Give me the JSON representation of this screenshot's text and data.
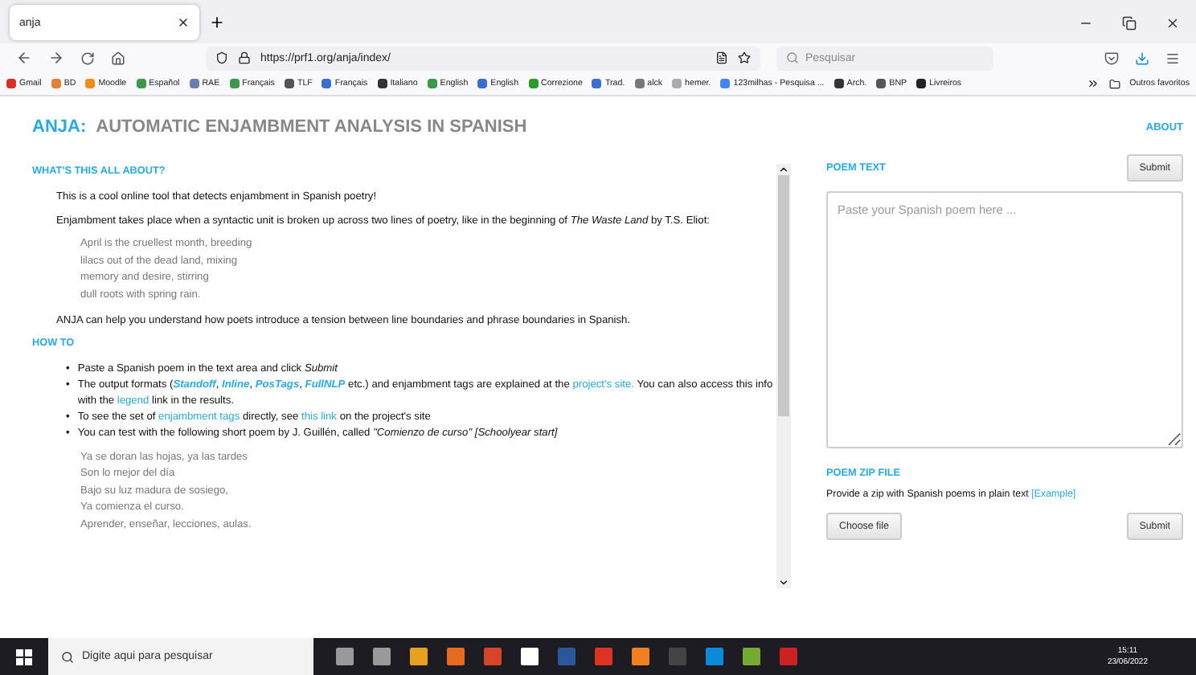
{
  "browser": {
    "tab_title": "anja",
    "url": "https://prf1.org/anja/index/",
    "search_placeholder": "Pesquisar",
    "bookmarks": [
      {
        "label": "Gmail",
        "color": "#d93025"
      },
      {
        "label": "BD",
        "color": "#e0803a"
      },
      {
        "label": "Moodle",
        "color": "#f08c1a"
      },
      {
        "label": "Español",
        "color": "#3a9a4a"
      },
      {
        "label": "RAE",
        "color": "#6a7fb0"
      },
      {
        "label": "Français",
        "color": "#3a9a4a"
      },
      {
        "label": "TLF",
        "color": "#555555"
      },
      {
        "label": "Français",
        "color": "#3a6fd0"
      },
      {
        "label": "Italiano",
        "color": "#333333"
      },
      {
        "label": "English",
        "color": "#3a9a4a"
      },
      {
        "label": "English",
        "color": "#3a6fd0"
      },
      {
        "label": "Correzione",
        "color": "#2a9a2a"
      },
      {
        "label": "Trad.",
        "color": "#3a6fd0"
      },
      {
        "label": "alck",
        "color": "#777777"
      },
      {
        "label": "hemer.",
        "color": "#aaaaaa"
      },
      {
        "label": "123milhas - Pesquisa ...",
        "color": "#4285f4"
      },
      {
        "label": "Arch.",
        "color": "#333333"
      },
      {
        "label": "BNP",
        "color": "#555555"
      },
      {
        "label": "Livreiros",
        "color": "#222222"
      }
    ],
    "other_bookmarks": "Outros favoritos"
  },
  "page": {
    "title_accent": "ANJA:",
    "title_rest": "AUTOMATIC ENJAMBMENT ANALYSIS IN SPANISH",
    "about_link": "ABOUT",
    "about": {
      "heading": "WHAT'S THIS ALL ABOUT?",
      "intro": "This is a cool online tool that detects enjambment in Spanish poetry!",
      "definition": "Enjambment takes place when a syntactic unit is broken up across two lines of poetry, like in the beginning of *The Waste Land* by T.S. Eliot:",
      "quote": [
        "April is the cruellest month, breeding",
        "lilacs out of the dead land, mixing",
        "memory and desire, stirring",
        "dull roots with spring rain."
      ],
      "closing": "ANJA can help you understand how poets introduce a tension between line boundaries and phrase boundaries in Spanish."
    },
    "howto": {
      "heading": "HOW TO",
      "marker": "•",
      "bullets": [
        [
          {
            "kind": "plain",
            "text": "Paste a Spanish poem in the text area and click "
          },
          {
            "kind": "italic",
            "text": "Submit"
          }
        ],
        [
          {
            "kind": "plain",
            "text": "The output formats ("
          },
          {
            "kind": "link_italic",
            "text": "Standoff"
          },
          {
            "kind": "plain",
            "text": ", "
          },
          {
            "kind": "link_italic",
            "text": "Inline"
          },
          {
            "kind": "plain",
            "text": ", "
          },
          {
            "kind": "link_italic",
            "text": "PosTags"
          },
          {
            "kind": "plain",
            "text": ", "
          },
          {
            "kind": "link_italic",
            "text": "FullNLP"
          },
          {
            "kind": "plain",
            "text": " etc.) and enjambment tags are explained at the "
          },
          {
            "kind": "link",
            "text": "project's site."
          },
          {
            "kind": "plain",
            "text": " You can also access this info with the "
          },
          {
            "kind": "link",
            "text": "legend"
          },
          {
            "kind": "plain",
            "text": " link in the results."
          }
        ],
        [
          {
            "kind": "plain",
            "text": "To see the set of "
          },
          {
            "kind": "link",
            "text": "enjambment tags"
          },
          {
            "kind": "plain",
            "text": " directly, see "
          },
          {
            "kind": "link",
            "text": "this link"
          },
          {
            "kind": "plain",
            "text": " on the project's site"
          }
        ],
        [
          {
            "kind": "plain",
            "text": "You can test with the following short poem by J. Guillén, called "
          },
          {
            "kind": "italic",
            "text": "\"Comienzo de curso\" [Schoolyear start]"
          }
        ]
      ],
      "poem": [
        "Ya se doran las hojas, ya las tardes",
        "Son lo mejor del día",
        "Bajo su luz madura de sosiego,",
        "Ya comienza el curso.",
        "Aprender, enseñar, lecciones, aulas."
      ]
    },
    "poem_text": {
      "heading": "POEM TEXT",
      "submit": "Submit",
      "placeholder": "Paste your Spanish poem here ..."
    },
    "zip": {
      "heading": "POEM ZIP FILE",
      "description": "Provide a zip with Spanish poems in plain text",
      "example_link": "[Example]",
      "choose": "Choose file",
      "submit": "Submit"
    }
  },
  "taskbar": {
    "search_placeholder": "Digite aqui para pesquisar",
    "time": "15:11",
    "date": "23/06/2022"
  }
}
